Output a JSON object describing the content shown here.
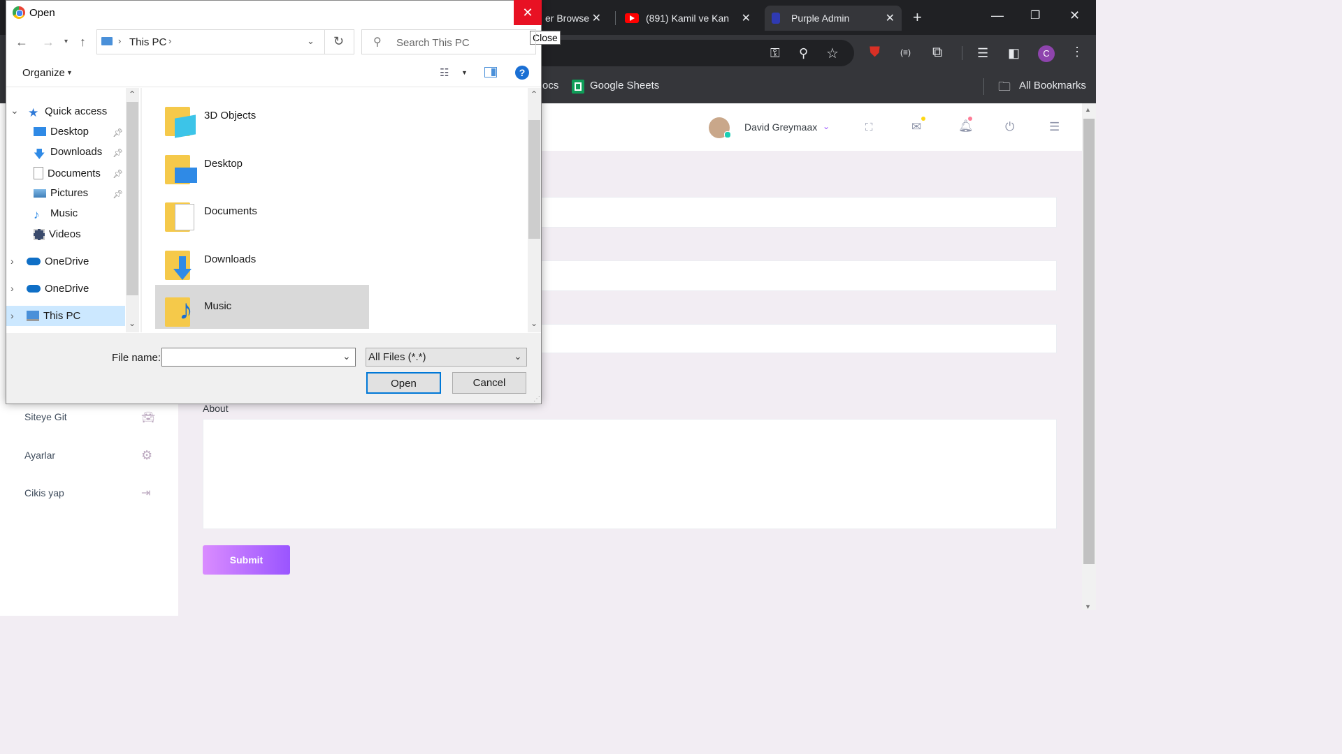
{
  "browser": {
    "tabs": [
      {
        "label": "er Browse"
      },
      {
        "label": "(891) Kamil ve Kan"
      },
      {
        "label": "Purple Admin"
      }
    ],
    "new_tab": "+",
    "profile_initial": "C",
    "bookmarks": {
      "partial_item": "ocs",
      "sheets": "Google Sheets",
      "all": "All Bookmarks"
    }
  },
  "page": {
    "user_name": "David Greymaax",
    "sidebar": [
      {
        "label": "Siteye Git"
      },
      {
        "label": "Ayarlar"
      },
      {
        "label": "Cikis yap"
      }
    ],
    "about_label": "About",
    "submit_label": "Submit"
  },
  "dialog": {
    "title": "Open",
    "close_tooltip": "Close",
    "address": {
      "root": "This PC"
    },
    "search_placeholder": "Search This PC",
    "organize_label": "Organize",
    "help": "?",
    "nav_tree": {
      "quick_access": "Quick access",
      "items": [
        {
          "label": "Desktop",
          "pinned": true
        },
        {
          "label": "Downloads",
          "pinned": true
        },
        {
          "label": "Documents",
          "pinned": true
        },
        {
          "label": "Pictures",
          "pinned": true
        },
        {
          "label": "Music",
          "pinned": false
        },
        {
          "label": "Videos",
          "pinned": false
        }
      ],
      "onedrive_1": "OneDrive",
      "onedrive_2": "OneDrive",
      "this_pc": "This PC"
    },
    "files": [
      {
        "label": "3D Objects",
        "icon": "3d-objects-folder-icon"
      },
      {
        "label": "Desktop",
        "icon": "desktop-folder-icon"
      },
      {
        "label": "Documents",
        "icon": "documents-folder-icon"
      },
      {
        "label": "Downloads",
        "icon": "downloads-folder-icon"
      },
      {
        "label": "Music",
        "icon": "music-folder-icon",
        "selected": true
      }
    ],
    "file_name_label": "File name:",
    "file_name_value": "",
    "file_type": "All Files (*.*)",
    "open_label": "Open",
    "cancel_label": "Cancel"
  },
  "colors": {
    "accent": "#9a55ff",
    "dialog_close": "#e81123",
    "selection": "#d9d9d9"
  }
}
